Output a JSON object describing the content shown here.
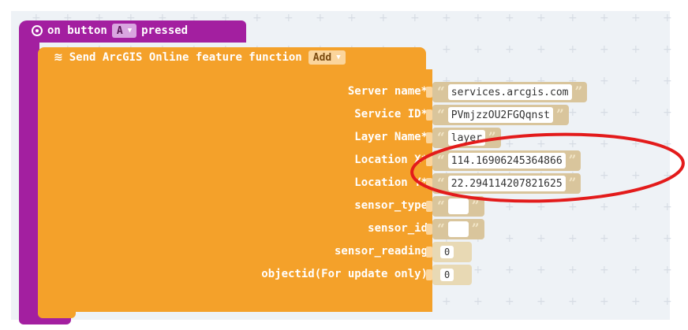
{
  "event_block": {
    "prefix": "on button",
    "button_value": "A",
    "suffix": "pressed",
    "color": "#a31fa0"
  },
  "function_block": {
    "title": "Send ArcGIS Online feature function",
    "action_value": "Add",
    "color": "#f4a12a"
  },
  "params": [
    {
      "label": "Server name*",
      "value": "services.arcgis.com",
      "kind": "string"
    },
    {
      "label": "Service ID*",
      "value": "PVmjzzOU2FGQqnst",
      "kind": "string"
    },
    {
      "label": "Layer Name*",
      "value": "layer",
      "kind": "string"
    },
    {
      "label": "Location X*",
      "value": "114.16906245364866",
      "kind": "string"
    },
    {
      "label": "Location Y*",
      "value": "22.294114207821625",
      "kind": "string"
    },
    {
      "label": "sensor_type",
      "value": "",
      "kind": "string"
    },
    {
      "label": "sensor_id",
      "value": "",
      "kind": "string"
    },
    {
      "label": "sensor_reading",
      "value": "0",
      "kind": "number"
    },
    {
      "label": "objectid(For update only)",
      "value": "0",
      "kind": "number"
    }
  ],
  "quote_open": "“",
  "quote_close": "”",
  "annotation_color": "#e31b1b"
}
